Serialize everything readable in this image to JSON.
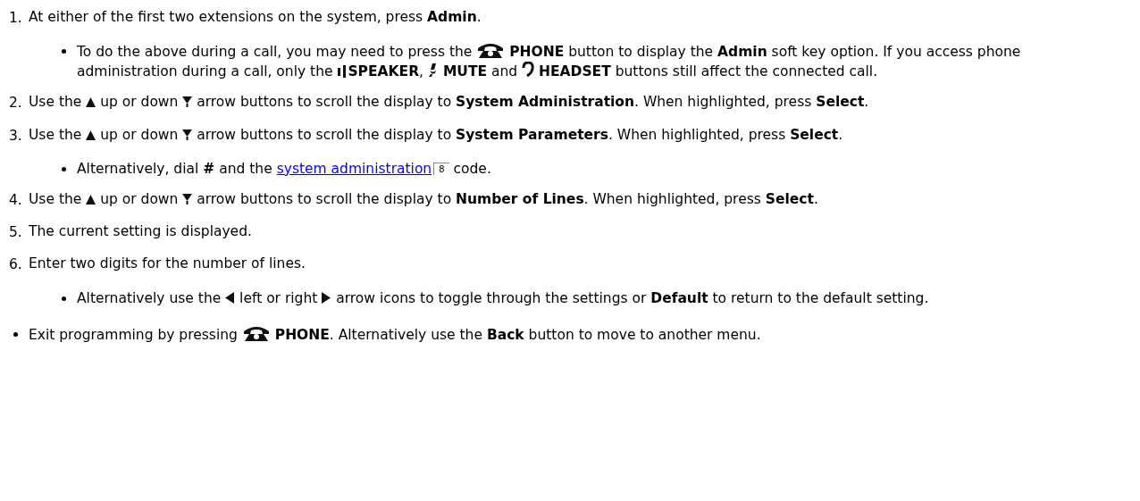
{
  "steps": [
    {
      "number": "1.",
      "parts": [
        {
          "kind": "text",
          "text": "At either of the first two extensions on the system, press **Admin**."
        }
      ],
      "notes": [
        {
          "parts": [
            {
              "kind": "text",
              "text": "To do the above during a call, you may need to press the "
            },
            {
              "kind": "phone"
            },
            {
              "kind": "text",
              "text": " **PHONE** button to display the **Admin** soft key option. If you access phone administration during a call, only the "
            },
            {
              "kind": "speaker"
            },
            {
              "kind": "text",
              "text": "**SPEAKER**, "
            },
            {
              "kind": "mute"
            },
            {
              "kind": "text",
              "text": " **MUTE** and "
            },
            {
              "kind": "headset"
            },
            {
              "kind": "text",
              "text": " **HEADSET** buttons still affect the connected call."
            }
          ]
        }
      ]
    },
    {
      "number": "2.",
      "parts": [
        {
          "kind": "text",
          "text": "Use the "
        },
        {
          "kind": "up"
        },
        {
          "kind": "text",
          "text": " up or down "
        },
        {
          "kind": "down"
        },
        {
          "kind": "text",
          "text": " arrow buttons to scroll the display to **System Administration**. When highlighted, press **Select**."
        }
      ]
    },
    {
      "number": "3.",
      "parts": [
        {
          "kind": "text",
          "text": "Use the "
        },
        {
          "kind": "up"
        },
        {
          "kind": "text",
          "text": " up or down "
        },
        {
          "kind": "down"
        },
        {
          "kind": "text",
          "text": " arrow buttons to scroll the display to **System Parameters**. When highlighted, press **Select**."
        }
      ],
      "notes": [
        {
          "parts": [
            {
              "kind": "text",
              "text": "Alternatively, dial **#** and the "
            },
            {
              "kind": "link",
              "text": "system administration",
              "page": "8"
            },
            {
              "kind": "text",
              "text": " code."
            }
          ]
        }
      ]
    },
    {
      "number": "4.",
      "parts": [
        {
          "kind": "text",
          "text": "Use the "
        },
        {
          "kind": "up"
        },
        {
          "kind": "text",
          "text": " up or down "
        },
        {
          "kind": "down"
        },
        {
          "kind": "text",
          "text": " arrow buttons to scroll the display to **Number of Lines**. When highlighted, press **Select**."
        }
      ]
    },
    {
      "number": "5.",
      "parts": [
        {
          "kind": "text",
          "text": "The current setting is displayed."
        }
      ]
    },
    {
      "number": "6.",
      "parts": [
        {
          "kind": "text",
          "text": "Enter two digits for the number of lines."
        }
      ],
      "notes": [
        {
          "parts": [
            {
              "kind": "text",
              "text": "Alternatively use the "
            },
            {
              "kind": "left"
            },
            {
              "kind": "text",
              "text": " left or right "
            },
            {
              "kind": "right"
            },
            {
              "kind": "text",
              "text": " arrow icons to toggle through the settings or **Default** to return to the default setting."
            }
          ]
        }
      ]
    }
  ],
  "final": [
    {
      "parts": [
        {
          "kind": "text",
          "text": "Exit programming by pressing "
        },
        {
          "kind": "phone"
        },
        {
          "kind": "text",
          "text": " **PHONE**. Alternatively use the **Back** button to move to another menu."
        }
      ]
    }
  ]
}
